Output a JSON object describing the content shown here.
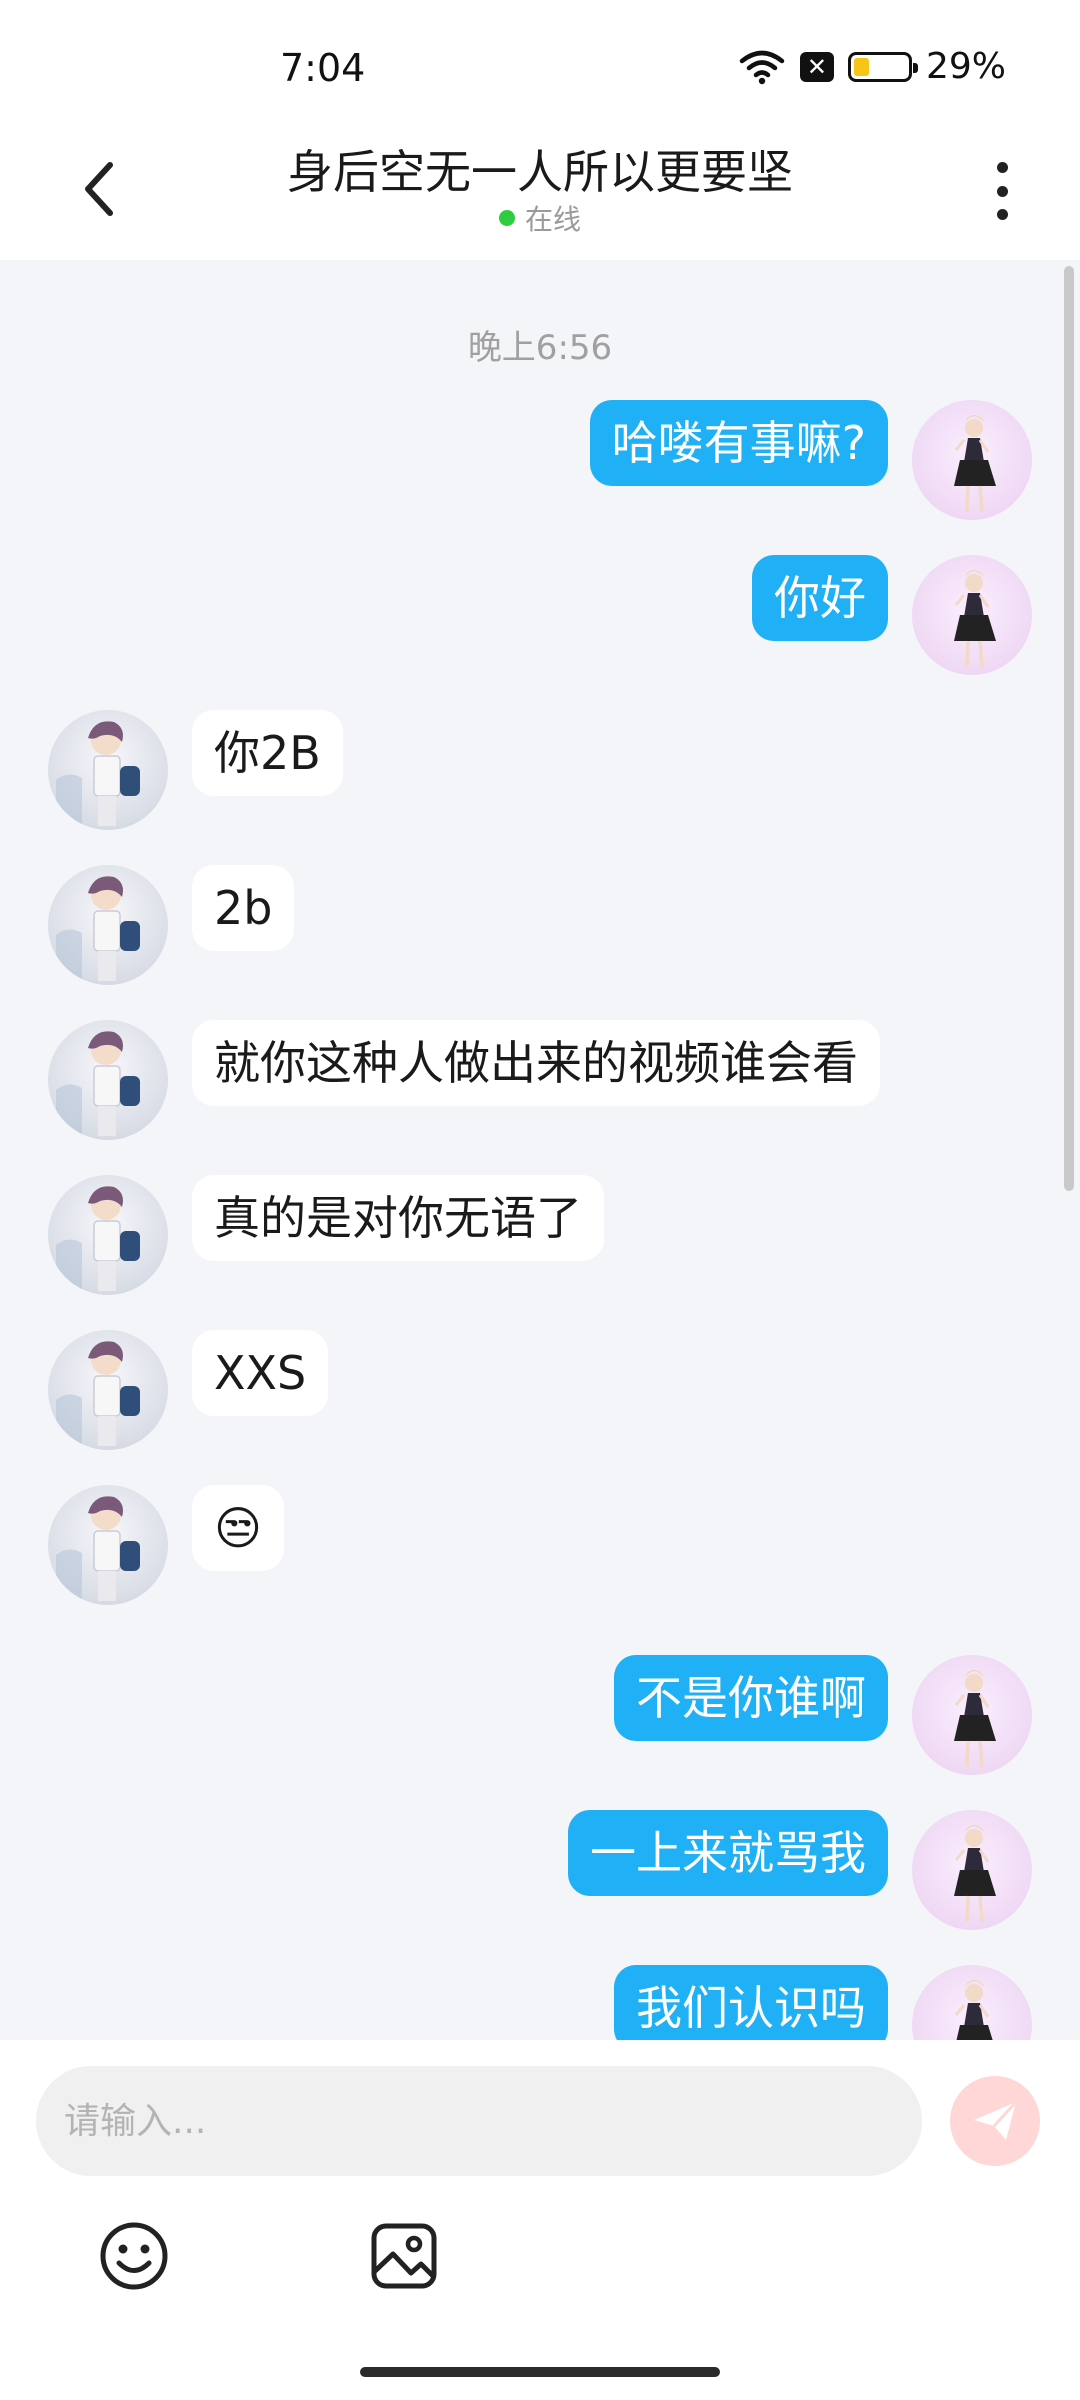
{
  "status_bar": {
    "time": "7:04",
    "battery": "29%",
    "battery_level": 0.29
  },
  "header": {
    "title": "身后空无一人所以更要坚",
    "status": "在线",
    "back_icon": "chevron-left-icon",
    "more_icon": "more-vertical-icon"
  },
  "chat": {
    "time_separator": "晚上6:56",
    "messages": [
      {
        "sender": "me",
        "text": "哈喽有事嘛?"
      },
      {
        "sender": "me",
        "text": "你好"
      },
      {
        "sender": "other",
        "text": "你2B"
      },
      {
        "sender": "other",
        "text": "2b"
      },
      {
        "sender": "other",
        "text": "就你这种人做出来的视频谁会看"
      },
      {
        "sender": "other",
        "text": "真的是对你无语了"
      },
      {
        "sender": "other",
        "text": "XXS"
      },
      {
        "sender": "other",
        "text": "😒"
      },
      {
        "sender": "me",
        "text": "不是你谁啊"
      },
      {
        "sender": "me",
        "text": "一上来就骂我"
      },
      {
        "sender": "me",
        "text": "我们认识吗"
      }
    ]
  },
  "composer": {
    "placeholder": "请输入...",
    "send_icon": "send-icon",
    "emoji_icon": "emoji-icon",
    "image_icon": "image-icon"
  },
  "colors": {
    "my_bubble": "#1fb0f5",
    "other_bubble": "#ffffff",
    "chat_bg": "#f4f5f8",
    "online": "#2ecc40",
    "send_btn": "#ffd7d7"
  }
}
